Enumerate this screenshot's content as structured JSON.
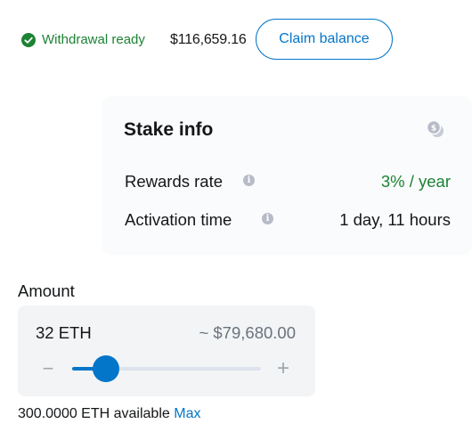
{
  "withdrawal": {
    "status_text": "Withdrawal ready",
    "amount": "$116,659.16",
    "claim_label": "Claim balance",
    "status_color": "#1c8234",
    "check_icon": "check-circle-icon"
  },
  "stake_info": {
    "title": "Stake info",
    "title_icon": "coins-icon",
    "rows": [
      {
        "label": "Rewards rate",
        "value": "3% / year",
        "info_icon": "info-icon"
      },
      {
        "label": "Activation time",
        "value": "1 day, 11 hours",
        "info_icon": "info-icon"
      }
    ]
  },
  "amount": {
    "label": "Amount",
    "value": "32 ETH",
    "fiat": "~ $79,680.00",
    "slider_fraction": 0.18,
    "minus_symbol": "−",
    "plus_symbol": "+",
    "available": "300.0000 ETH available",
    "max_label": "Max"
  },
  "colors": {
    "accent": "#0376c9",
    "success": "#1c8234",
    "muted": "#6a737d"
  }
}
